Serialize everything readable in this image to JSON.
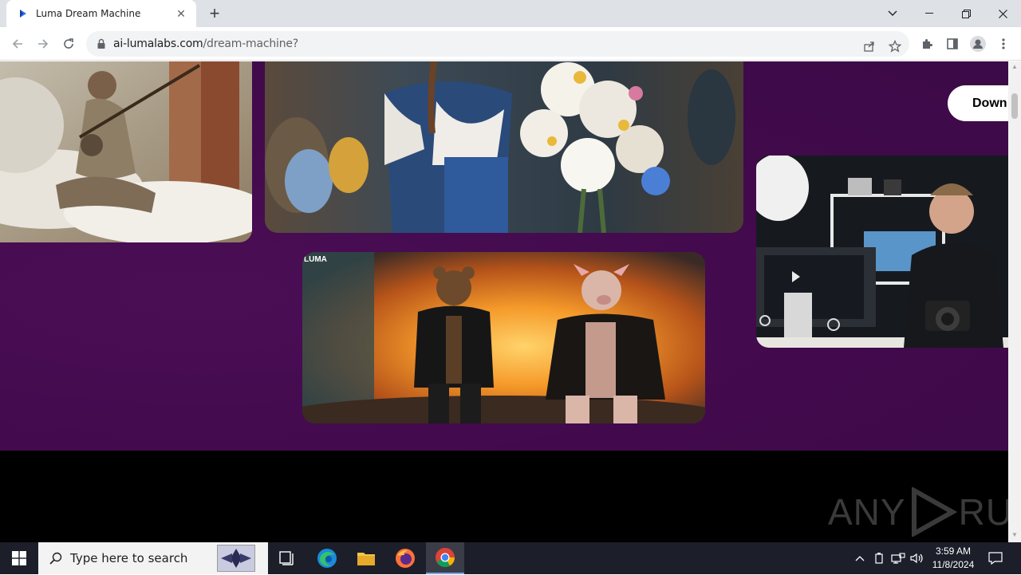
{
  "browser": {
    "tab_title": "Luma Dream Machine",
    "url_host": "ai-lumalabs.com",
    "url_path": "/dream-machine?"
  },
  "page": {
    "download_label": "Down",
    "video_badge": "LUMA",
    "images": [
      {
        "name": "old-man-banjo-image",
        "alt": "Old bearded man playing banjo in clouds"
      },
      {
        "name": "woman-flowers-image",
        "alt": "Woman in dress holding bouquet of flowers"
      },
      {
        "name": "bear-pig-explosion-image",
        "alt": "Bear and pig in leather jackets walking from explosion"
      },
      {
        "name": "photographer-studio-image",
        "alt": "Man with camera at desk in studio"
      }
    ]
  },
  "watermark": {
    "left": "ANY",
    "right": "RUN"
  },
  "taskbar": {
    "search_placeholder": "Type here to search",
    "time": "3:59 AM",
    "date": "11/8/2024"
  },
  "colors": {
    "page_bg": "#430a4d",
    "footer_bg": "#000000",
    "taskbar_bg": "#1c1f2a"
  }
}
